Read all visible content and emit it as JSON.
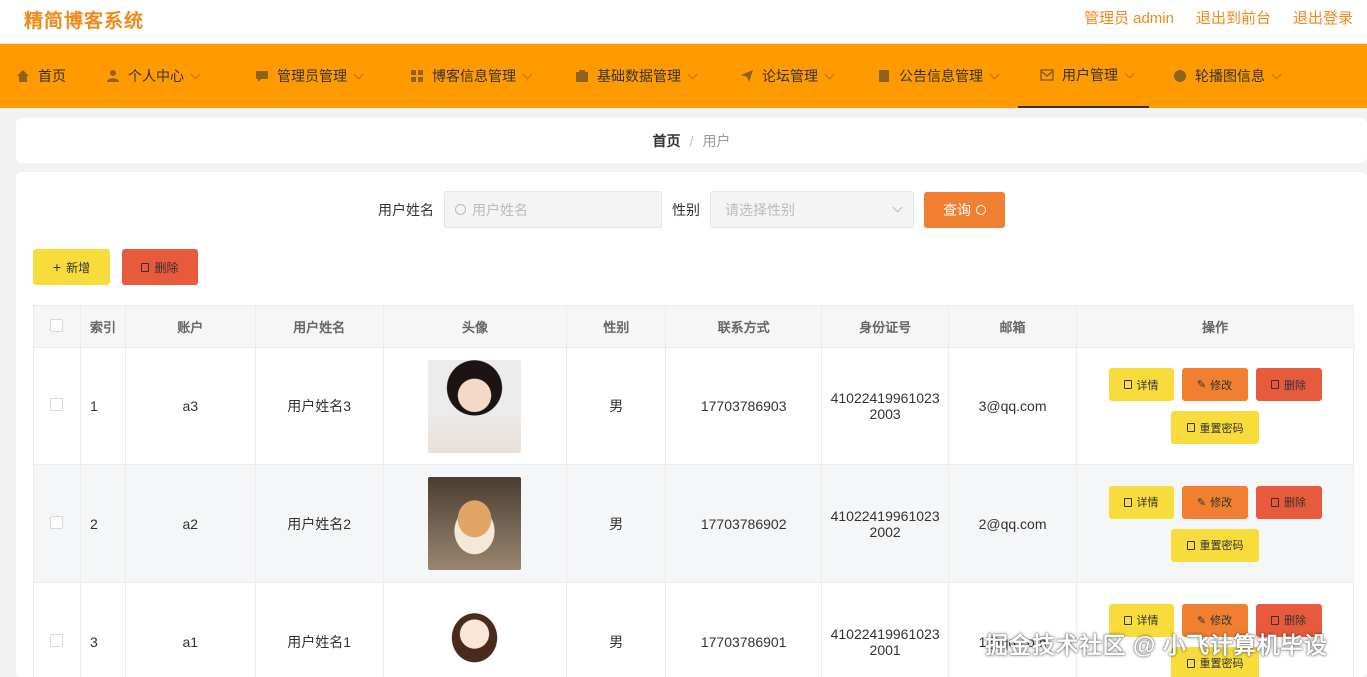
{
  "header": {
    "title": "精简博客系统",
    "user_label": "管理员 admin",
    "to_front": "退出到前台",
    "logout": "退出登录"
  },
  "nav": {
    "items": [
      {
        "label": "首页",
        "icon": "home-icon"
      },
      {
        "label": "个人中心",
        "icon": "user-icon"
      },
      {
        "label": "管理员管理",
        "icon": "chat-icon"
      },
      {
        "label": "博客信息管理",
        "icon": "grid-icon"
      },
      {
        "label": "基础数据管理",
        "icon": "box-icon"
      },
      {
        "label": "论坛管理",
        "icon": "send-icon"
      },
      {
        "label": "公告信息管理",
        "icon": "document-icon"
      },
      {
        "label": "用户管理",
        "icon": "mail-icon"
      },
      {
        "label": "轮播图信息",
        "icon": "image-icon"
      }
    ],
    "active_index": 7
  },
  "breadcrumb": {
    "home": "首页",
    "sep": "/",
    "current": "用户"
  },
  "search": {
    "name_label": "用户姓名",
    "name_placeholder": "用户姓名",
    "gender_label": "性别",
    "gender_placeholder": "请选择性别",
    "query_label": "查询"
  },
  "actions": {
    "add_label": "新增",
    "delete_label": "删除"
  },
  "table": {
    "headers": [
      "索引",
      "账户",
      "用户姓名",
      "头像",
      "性别",
      "联系方式",
      "身份证号",
      "邮箱",
      "操作"
    ],
    "rows": [
      {
        "index": "1",
        "account": "a3",
        "name": "用户姓名3",
        "gender": "男",
        "phone": "17703786903",
        "id_line1": "41022419961023",
        "id_line2": "2003",
        "email": "3@qq.com"
      },
      {
        "index": "2",
        "account": "a2",
        "name": "用户姓名2",
        "gender": "男",
        "phone": "17703786902",
        "id_line1": "41022419961023",
        "id_line2": "2002",
        "email": "2@qq.com"
      },
      {
        "index": "3",
        "account": "a1",
        "name": "用户姓名1",
        "gender": "男",
        "phone": "17703786901",
        "id_line1": "41022419961023",
        "id_line2": "2001",
        "email": "1@qq.com"
      }
    ],
    "op_labels": {
      "detail": "详情",
      "edit": "修改",
      "delete": "删除",
      "reset": "重置密码"
    }
  },
  "watermark": "掘金技术社区 @ 小飞计算机毕设",
  "colors": {
    "accent": "#ff9a00",
    "title": "#f08a1c",
    "query": "#f08030",
    "add": "#f8dc3c",
    "delete": "#e85a3c"
  }
}
